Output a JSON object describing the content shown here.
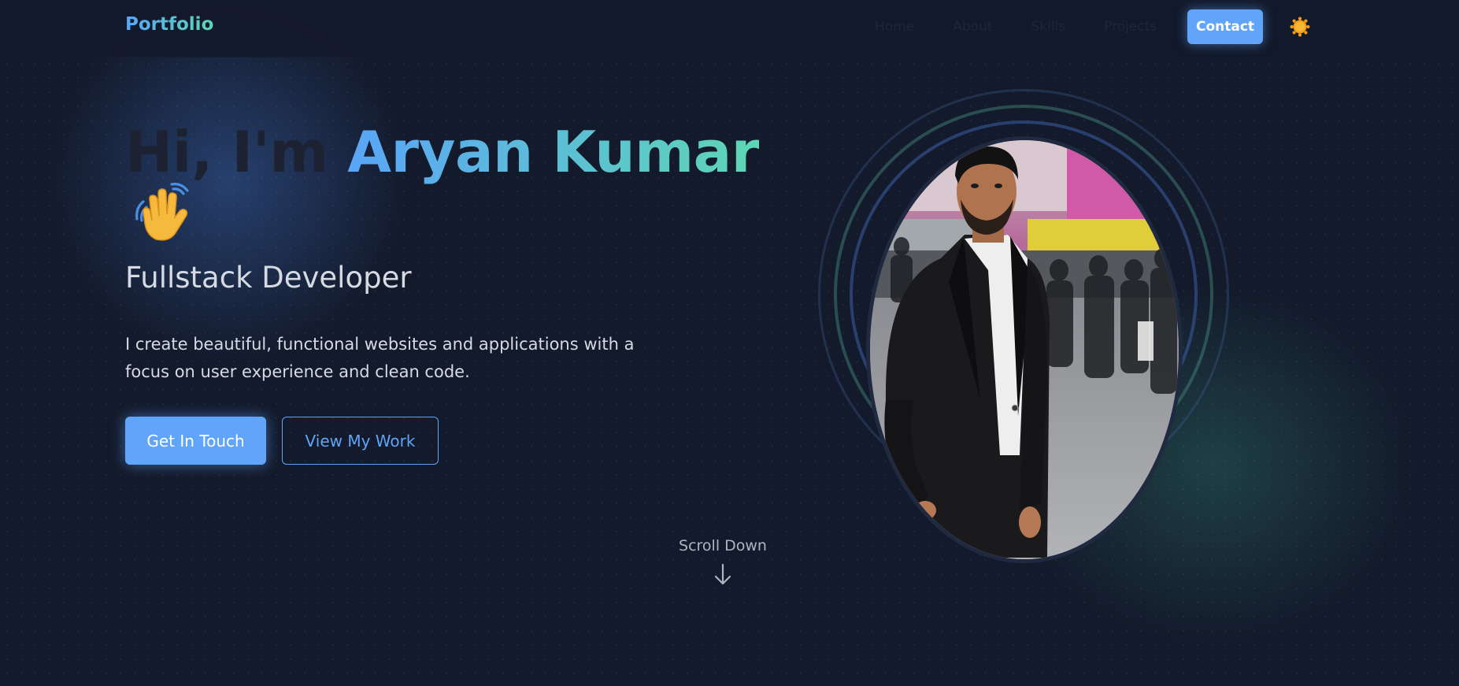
{
  "nav": {
    "logo": "Portfolio",
    "links": [
      "Home",
      "About",
      "Skills",
      "Projects"
    ],
    "contact_label": "Contact",
    "theme_icon": "sun-icon"
  },
  "hero": {
    "greeting": "Hi, I'm ",
    "name": "Aryan Kumar",
    "wave_icon": "waving-hand-icon",
    "subtitle": "Fullstack Developer",
    "description": "I create beautiful, functional websites and applications with a focus on user experience and clean code.",
    "primary_cta": "Get In Touch",
    "secondary_cta": "View My Work"
  },
  "profile": {
    "photo_icon": "profile-photo"
  },
  "scroll": {
    "label": "Scroll Down",
    "icon": "arrow-down-icon"
  },
  "colors": {
    "background": "#131a2b",
    "accent_blue": "#60a5fa",
    "accent_teal": "#5ed6b4",
    "text_light": "#d5dae3",
    "text_muted": "#aeb5c2"
  }
}
